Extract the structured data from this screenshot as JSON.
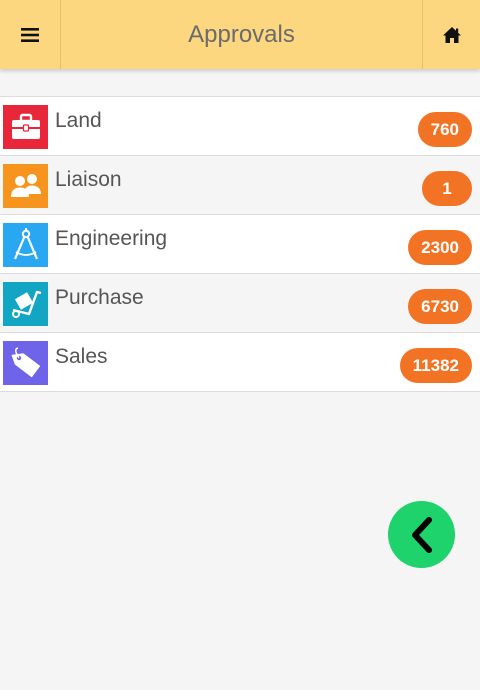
{
  "header": {
    "title": "Approvals",
    "menu_icon": "hamburger-menu-icon",
    "home_icon": "home-icon",
    "background": "#fcd77f"
  },
  "items": [
    {
      "label": "Land",
      "count": "760",
      "icon": "briefcase-icon",
      "tile_color": "#e8273a"
    },
    {
      "label": "Liaison",
      "count": "1",
      "icon": "people-icon",
      "tile_color": "#f7941d"
    },
    {
      "label": "Engineering",
      "count": "2300",
      "icon": "compass-icon",
      "tile_color": "#29a8f1"
    },
    {
      "label": "Purchase",
      "count": "6730",
      "icon": "cart-icon",
      "tile_color": "#13a6c4"
    },
    {
      "label": "Sales",
      "count": "11382",
      "icon": "price-tag-icon",
      "tile_color": "#6f63ea"
    }
  ],
  "badge_color": "#f27324",
  "fab": {
    "icon": "chevron-left-icon",
    "color": "#1ed36b"
  }
}
